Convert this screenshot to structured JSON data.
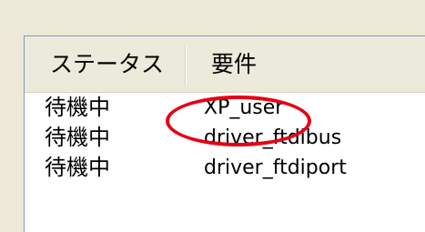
{
  "listview": {
    "columns": [
      {
        "label": "ステータス"
      },
      {
        "label": "要件"
      }
    ],
    "rows": [
      {
        "status": "待機中",
        "requirement": "XP_user"
      },
      {
        "status": "待機中",
        "requirement": "driver_ftdibus"
      },
      {
        "status": "待機中",
        "requirement": "driver_ftdiport"
      }
    ]
  },
  "annotation": {
    "shape": "ellipse",
    "color": "#e60012",
    "highlighted_row": 0
  }
}
